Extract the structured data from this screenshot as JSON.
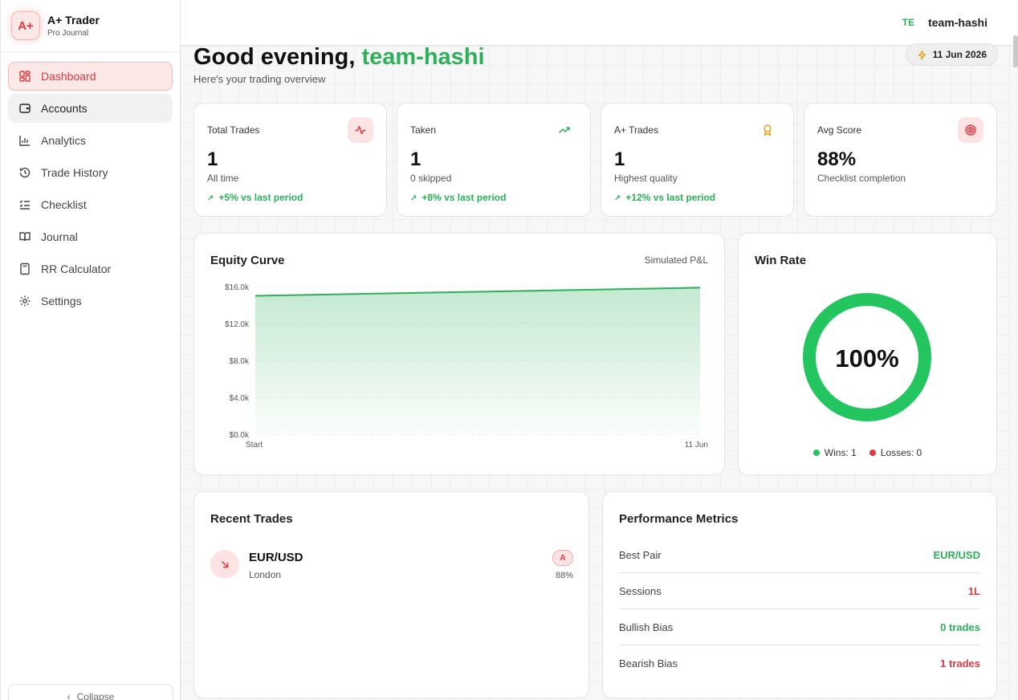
{
  "brand": {
    "logo": "A+",
    "name": "A+ Trader",
    "sub": "Pro Journal"
  },
  "nav": [
    {
      "label": "Dashboard",
      "icon": "dashboard-icon",
      "state": "active"
    },
    {
      "label": "Accounts",
      "icon": "wallet-icon",
      "state": "hover"
    },
    {
      "label": "Analytics",
      "icon": "bar-chart-icon",
      "state": ""
    },
    {
      "label": "Trade History",
      "icon": "history-icon",
      "state": ""
    },
    {
      "label": "Checklist",
      "icon": "checklist-icon",
      "state": ""
    },
    {
      "label": "Journal",
      "icon": "book-icon",
      "state": ""
    },
    {
      "label": "RR Calculator",
      "icon": "calculator-icon",
      "state": ""
    },
    {
      "label": "Settings",
      "icon": "gear-icon",
      "state": ""
    }
  ],
  "collapse_label": "Collapse",
  "user": {
    "initials": "TE",
    "name": "team-hashi"
  },
  "header": {
    "greeting_prefix": "Good evening, ",
    "greeting_name": "team-hashi",
    "subtitle": "Here's your trading overview",
    "date": "11 Jun 2026"
  },
  "stats": [
    {
      "label": "Total Trades",
      "value": "1",
      "desc": "All time",
      "change": "+5% vs last period",
      "icon": "activity-icon"
    },
    {
      "label": "Taken",
      "value": "1",
      "desc": "0 skipped",
      "change": "+8% vs last period",
      "icon": "trending-up-icon"
    },
    {
      "label": "A+ Trades",
      "value": "1",
      "desc": "Highest quality",
      "change": "+12% vs last period",
      "icon": "award-icon"
    },
    {
      "label": "Avg Score",
      "value": "88%",
      "desc": "Checklist completion",
      "change": "",
      "icon": "target-icon"
    }
  ],
  "equity": {
    "title": "Equity Curve",
    "aside": "Simulated P&L"
  },
  "chart_data": {
    "type": "area",
    "x": [
      "Start",
      "11 Jun"
    ],
    "values": [
      15000,
      15880
    ],
    "ylim": [
      0,
      16000
    ],
    "yticks": [
      "$0.0k",
      "$4.0k",
      "$8.0k",
      "$12.0k",
      "$16.0k"
    ],
    "ytick_values": [
      0,
      4000,
      8000,
      12000,
      16000
    ],
    "color": "#2cb05a",
    "grid": true
  },
  "winrate": {
    "title": "Win Rate",
    "value": "100%",
    "fraction": 1.0,
    "wins_label": "Wins: 1",
    "losses_label": "Losses: 0",
    "win_color": "#22c55e",
    "loss_color": "#e0393e"
  },
  "recent": {
    "title": "Recent Trades",
    "trades": [
      {
        "pair": "EUR/USD",
        "session": "London",
        "grade": "A",
        "score": "88%"
      }
    ]
  },
  "metrics": {
    "title": "Performance Metrics",
    "rows": [
      {
        "label": "Best Pair",
        "value": "EUR/USD",
        "color": "#2cb05a"
      },
      {
        "label": "Sessions",
        "value": "1L",
        "color": "#e0393e"
      },
      {
        "label": "Bullish Bias",
        "value": "0 trades",
        "color": "#2cb05a"
      },
      {
        "label": "Bearish Bias",
        "value": "1 trades",
        "color": "#e0393e"
      }
    ]
  }
}
